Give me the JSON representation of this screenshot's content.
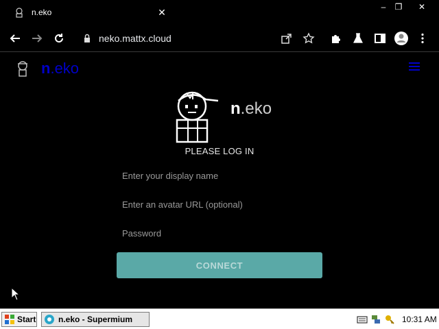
{
  "browser": {
    "tab_title": "n.eko",
    "tab_close": "✕",
    "url": "neko.mattx.cloud",
    "window_controls": {
      "minimize": "–",
      "restore": "❐",
      "close": "✕"
    }
  },
  "page": {
    "brand_prefix": "n",
    "brand_suffix": ".eko",
    "login": {
      "brand_prefix": "n",
      "brand_suffix": ".eko",
      "heading": "PLEASE LOG IN",
      "display_name_placeholder": "Enter your display name",
      "avatar_placeholder": "Enter an avatar URL (optional)",
      "password_placeholder": "Password",
      "connect_label": "CONNECT"
    },
    "colors": {
      "accent": "#0000c8",
      "button": "#5aa9a7",
      "background": "#000000"
    }
  },
  "taskbar": {
    "start_label": "Start",
    "task_label": "n.eko - Supermium",
    "clock": "10:31 AM"
  }
}
